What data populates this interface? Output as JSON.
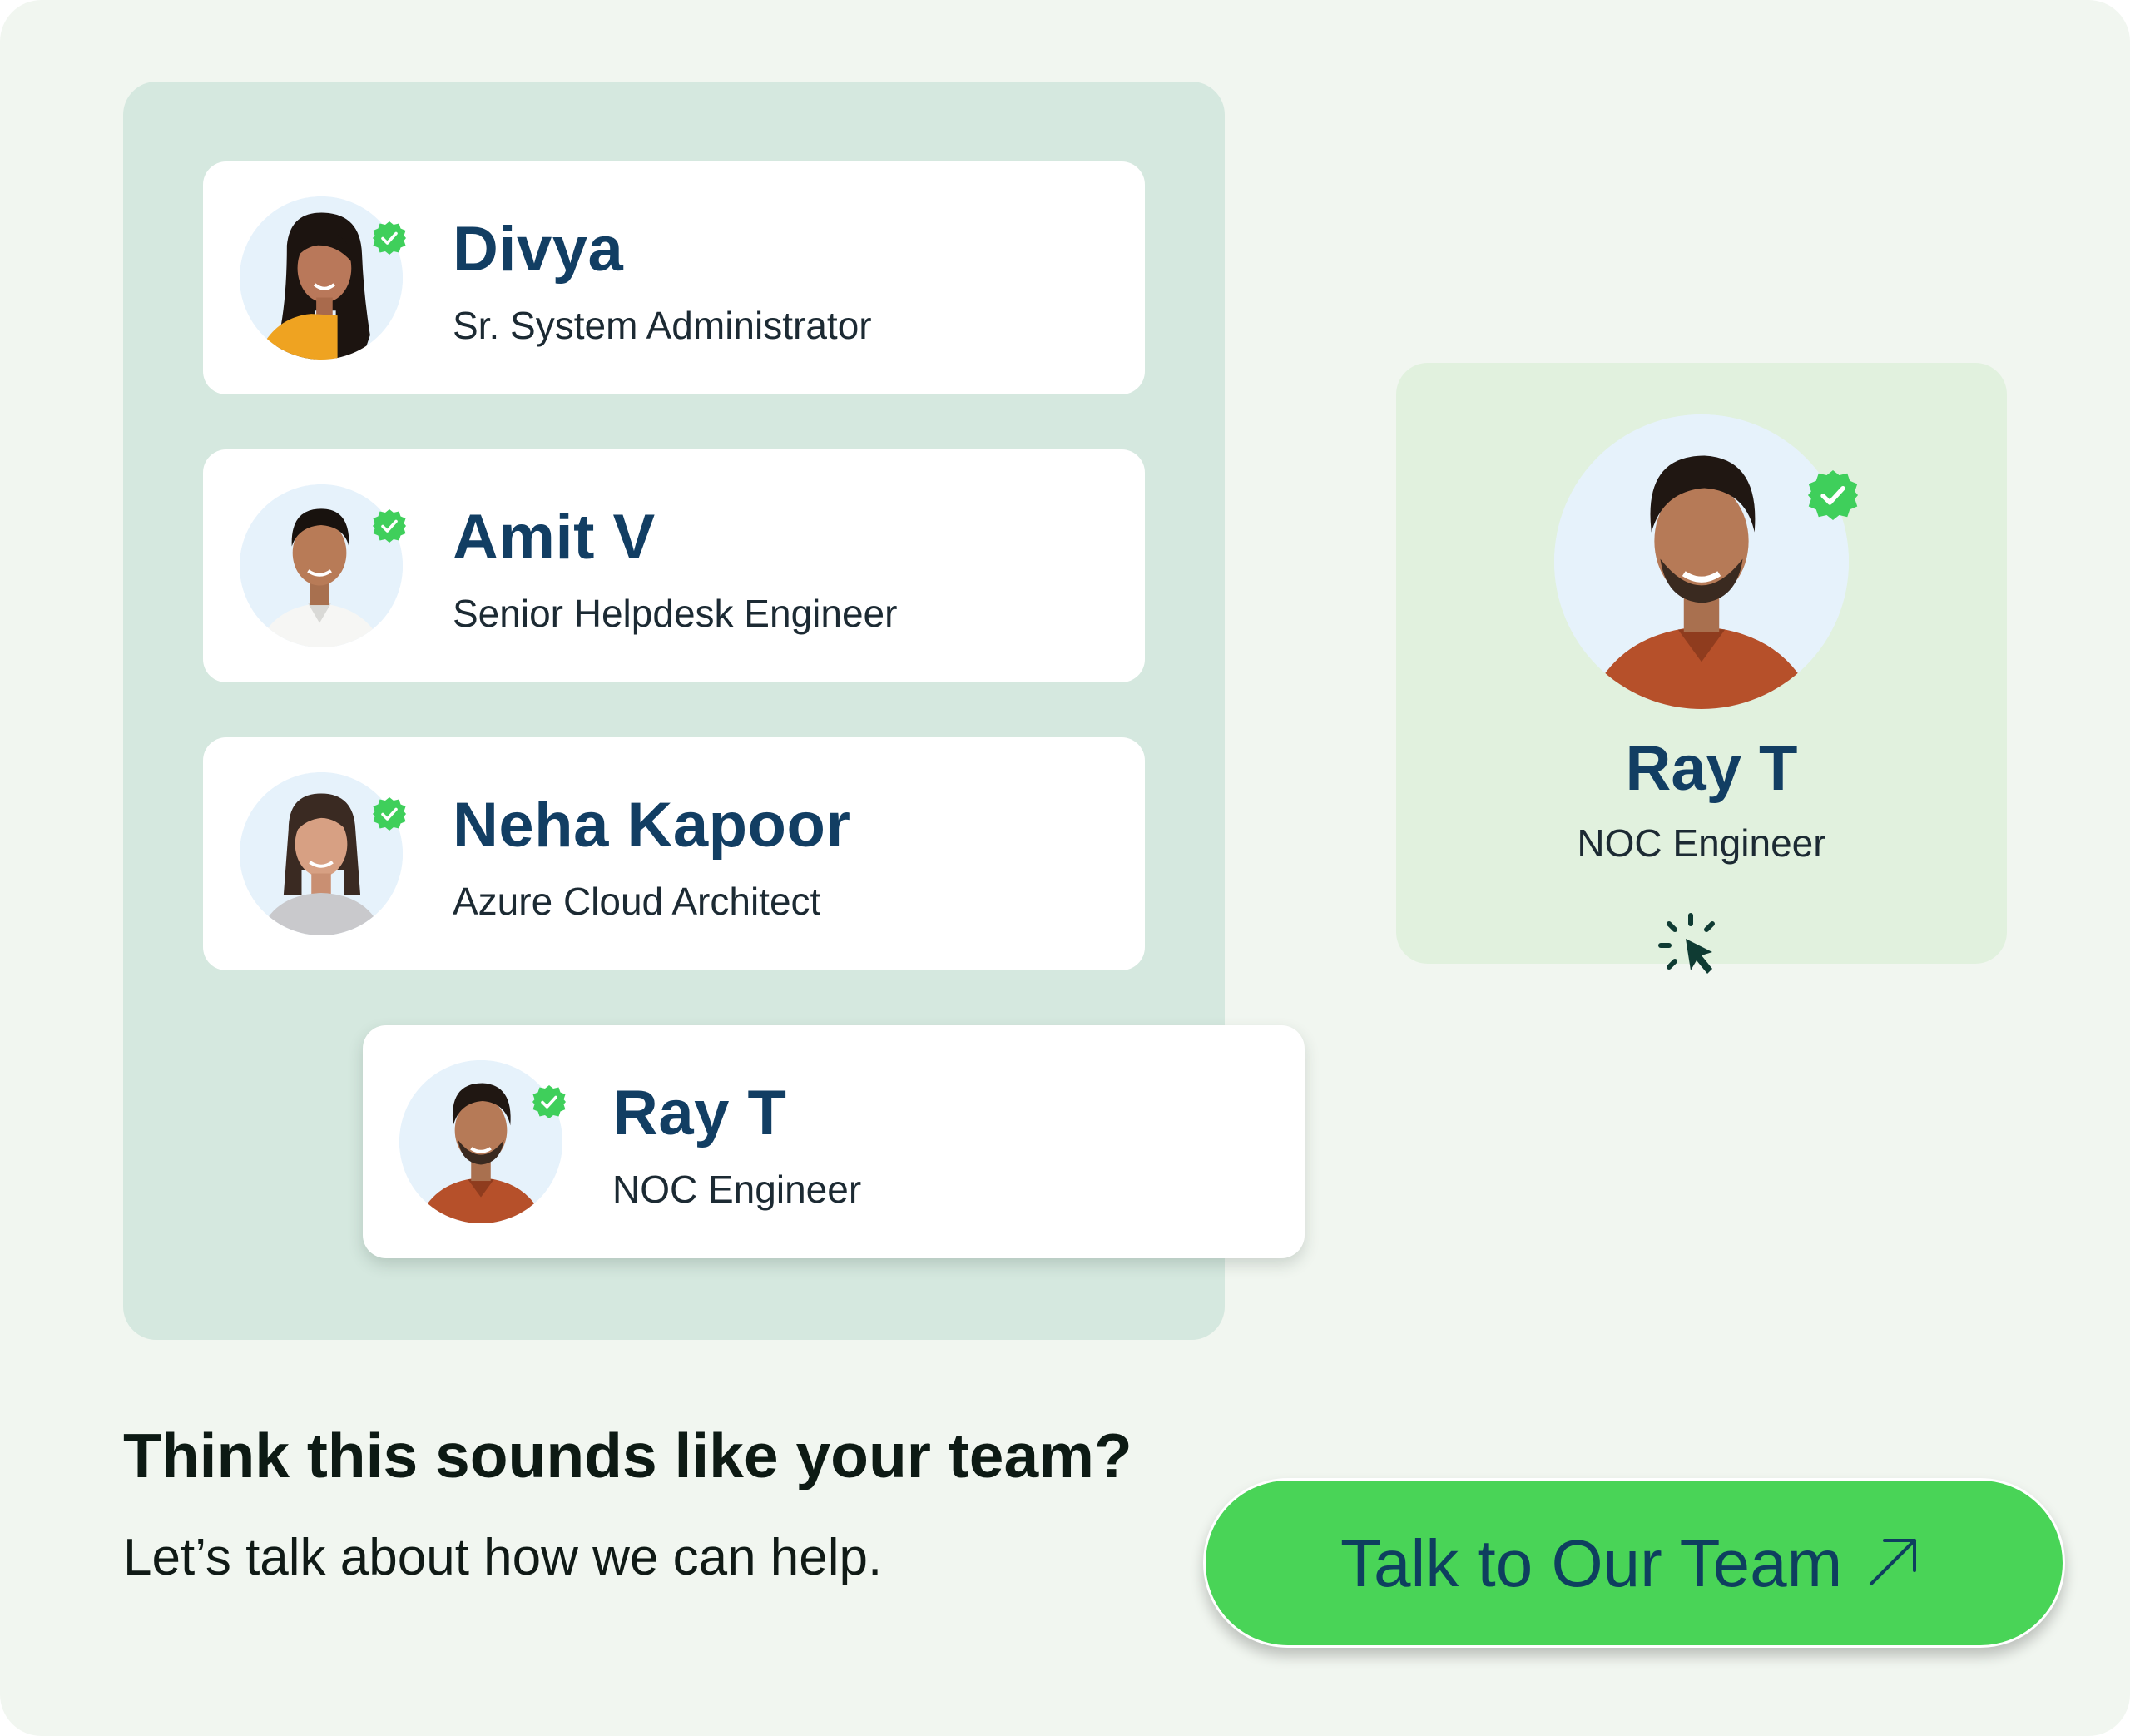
{
  "team_list": [
    {
      "name": "Divya",
      "role": "Sr. System Administrator",
      "avatar_icon": "woman-portrait-icon",
      "verified": true
    },
    {
      "name": "Amit V",
      "role": "Senior Helpdesk Engineer",
      "avatar_icon": "man-portrait-icon",
      "verified": true
    },
    {
      "name": "Neha Kapoor",
      "role": "Azure Cloud Architect",
      "avatar_icon": "woman-portrait-icon",
      "verified": true
    },
    {
      "name": "Ray T",
      "role": "NOC Engineer",
      "avatar_icon": "man-portrait-icon",
      "verified": true
    }
  ],
  "selected": {
    "name": "Ray T",
    "role": "NOC Engineer",
    "verified": true
  },
  "cta": {
    "heading": "Think this sounds like your team?",
    "subheading": "Let’s talk about how we can help.",
    "button_label": "Talk to Our Team",
    "button_icon": "arrow-up-right-icon"
  },
  "colors": {
    "background": "#f1f6f0",
    "list_panel": "#d5e8df",
    "detail_card": "#e1f1de",
    "name_text": "#123e63",
    "verified_badge": "#3fcf5b",
    "button": "#49d457"
  }
}
